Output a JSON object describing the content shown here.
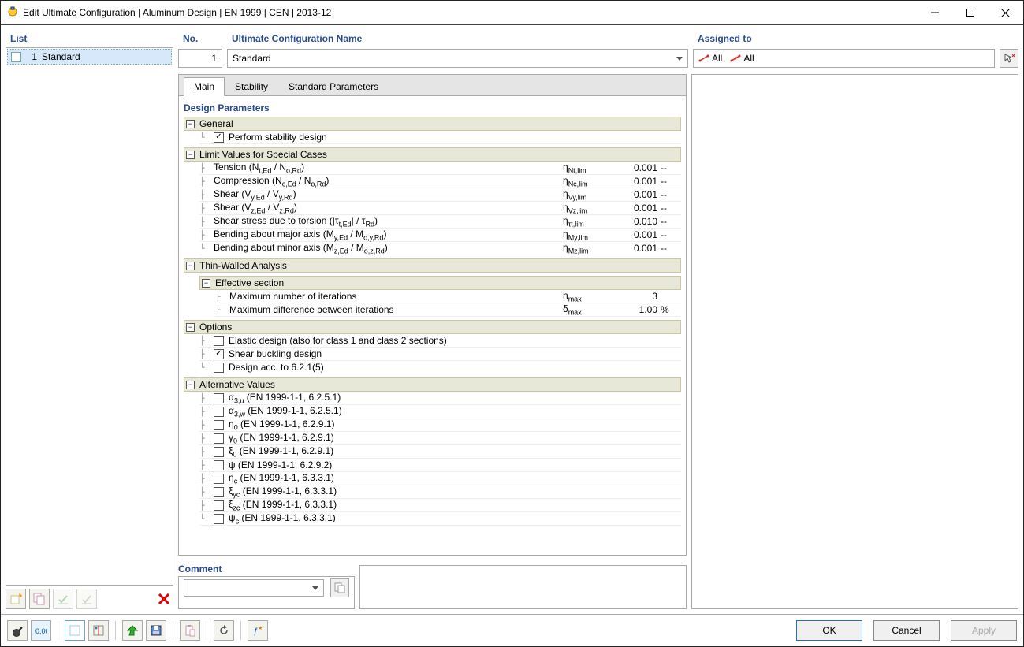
{
  "title": "Edit Ultimate Configuration | Aluminum Design | EN 1999 | CEN | 2013-12",
  "left": {
    "title": "List",
    "item_no": "1",
    "item_name": "Standard"
  },
  "no": {
    "title": "No.",
    "value": "1"
  },
  "name": {
    "title": "Ultimate Configuration Name",
    "value": "Standard"
  },
  "assigned": {
    "title": "Assigned to",
    "all1": "All",
    "all2": "All"
  },
  "tabs": {
    "main": "Main",
    "stability": "Stability",
    "std": "Standard Parameters"
  },
  "dp": {
    "title": "Design Parameters"
  },
  "general": {
    "title": "General",
    "perform": "Perform stability design"
  },
  "limits": {
    "title": "Limit Values for Special Cases",
    "rows": [
      {
        "label": "Tension (N<sub>t,Ed</sub> / N<sub>o,Rd</sub>)",
        "sym": "η<sub>Nt,lim</sub>",
        "val": "0.001",
        "unit": "--"
      },
      {
        "label": "Compression (N<sub>c,Ed</sub> / N<sub>o,Rd</sub>)",
        "sym": "η<sub>Nc,lim</sub>",
        "val": "0.001",
        "unit": "--"
      },
      {
        "label": "Shear (V<sub>y,Ed</sub> / V<sub>y,Rd</sub>)",
        "sym": "η<sub>Vy,lim</sub>",
        "val": "0.001",
        "unit": "--"
      },
      {
        "label": "Shear (V<sub>z,Ed</sub> / V<sub>z,Rd</sub>)",
        "sym": "η<sub>Vz,lim</sub>",
        "val": "0.001",
        "unit": "--"
      },
      {
        "label": "Shear stress due to torsion (|τ<sub>t,Ed</sub>| / τ<sub>Rd</sub>)",
        "sym": "η<sub>τt,lim</sub>",
        "val": "0.010",
        "unit": "--"
      },
      {
        "label": "Bending about major axis (M<sub>y,Ed</sub> / M<sub>o,y,Rd</sub>)",
        "sym": "η<sub>My,lim</sub>",
        "val": "0.001",
        "unit": "--"
      },
      {
        "label": "Bending about minor axis (M<sub>z,Ed</sub> / M<sub>o,z,Rd</sub>)",
        "sym": "η<sub>Mz,lim</sub>",
        "val": "0.001",
        "unit": "--"
      }
    ]
  },
  "thin": {
    "title": "Thin-Walled Analysis",
    "sub": "Effective section",
    "rows": [
      {
        "label": "Maximum number of iterations",
        "sym": "n<sub>max</sub>",
        "val": "3",
        "unit": ""
      },
      {
        "label": "Maximum difference between iterations",
        "sym": "δ<sub>max</sub>",
        "val": "1.00",
        "unit": "%"
      }
    ]
  },
  "options": {
    "title": "Options",
    "items": [
      {
        "label": "Elastic design (also for class 1 and class 2 sections)",
        "checked": false
      },
      {
        "label": "Shear buckling design",
        "checked": true
      },
      {
        "label": "Design acc. to 6.2.1(5)",
        "checked": false
      }
    ]
  },
  "alt": {
    "title": "Alternative Values",
    "items": [
      "α<sub>3,u</sub> (EN 1999-1-1, 6.2.5.1)",
      "α<sub>3,w</sub> (EN 1999-1-1, 6.2.5.1)",
      "η<sub>0</sub> (EN 1999-1-1, 6.2.9.1)",
      "γ<sub>0</sub> (EN 1999-1-1, 6.2.9.1)",
      "ξ<sub>0</sub> (EN 1999-1-1, 6.2.9.1)",
      "ψ (EN 1999-1-1, 6.2.9.2)",
      "η<sub>c</sub> (EN 1999-1-1, 6.3.3.1)",
      "ξ<sub>yc</sub> (EN 1999-1-1, 6.3.3.1)",
      "ξ<sub>zc</sub> (EN 1999-1-1, 6.3.3.1)",
      "ψ<sub>c</sub> (EN 1999-1-1, 6.3.3.1)"
    ]
  },
  "comment": {
    "title": "Comment"
  },
  "buttons": {
    "ok": "OK",
    "cancel": "Cancel",
    "apply": "Apply"
  }
}
